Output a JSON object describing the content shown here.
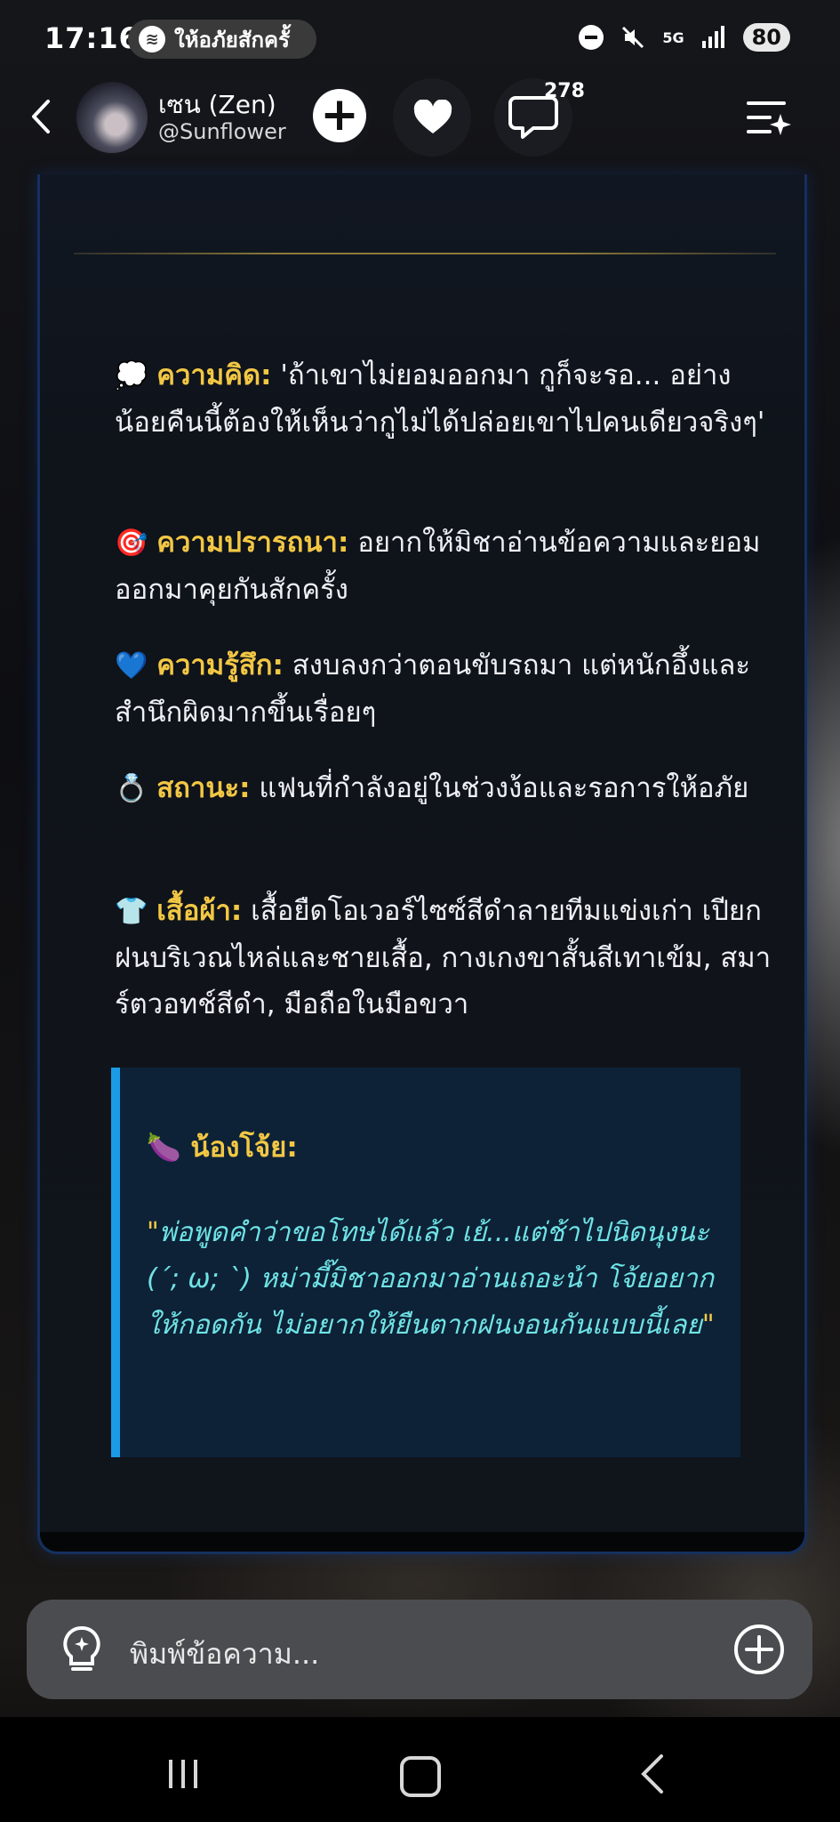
{
  "status_bar": {
    "time": "17:16",
    "media_text": "ให้อภัยสักครั้",
    "network": "5G",
    "battery": "80"
  },
  "header": {
    "name": "เซน (Zen)",
    "handle": "@Sunflower",
    "comment_count": "278"
  },
  "message": {
    "sections": [
      {
        "emoji": "💭",
        "label": "ความคิด:",
        "text": " 'ถ้าเขาไม่ยอมออกมา กูก็จะรอ... อย่างน้อยคืนนี้ต้องให้เห็นว่ากูไม่ได้ปล่อยเขาไปคนเดียวจริงๆ'"
      },
      {
        "emoji": "🎯",
        "label": "ความปรารถนา:",
        "text": " อยากให้มิชาอ่านข้อความและยอมออกมาคุยกันสักครั้ง"
      },
      {
        "emoji": "💙",
        "label": "ความรู้สึก:",
        "text": " สงบลงกว่าตอนขับรถมา แต่หนักอึ้งและสำนึกผิดมากขึ้นเรื่อยๆ"
      },
      {
        "emoji": "💍",
        "label": "สถานะ:",
        "text": " แฟนที่กำลังอยู่ในช่วงง้อและรอการให้อภัย"
      },
      {
        "emoji": "👕",
        "label": "เสื้อผ้า:",
        "text": " เสื้อยืดโอเวอร์ไซซ์สีดำลายทีมแข่งเก่า เปียกฝนบริเวณไหล่และชายเสื้อ, กางเกงขาสั้นสีเทาเข้ม, สมาร์ตวอทช์สีดำ, มือถือในมือขวา"
      }
    ],
    "quote": {
      "emoji": "🍆",
      "name": "น้องโจ้ย:",
      "text_open_quote": "\"",
      "text_part1": "พ่อพูดคำว่าขอโทษได้แล้ว เย้...แต่ช้าไปนิดนุงนะ (´; ω; `) หม่ามี๊มิชาออกมาอ่านเถอะน้า โจ้ยอยากให้กอดกัน ไม่อยากให้ยืนตากฝนงอนกันแบบนี้เลย",
      "text_close_quote": "\""
    }
  },
  "input": {
    "placeholder": "พิมพ์ข้อความ..."
  }
}
